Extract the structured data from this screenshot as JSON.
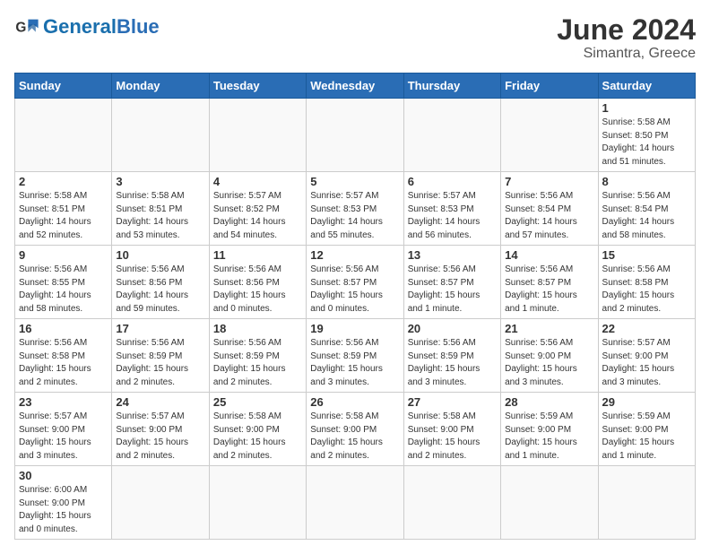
{
  "header": {
    "logo_general": "General",
    "logo_blue": "Blue",
    "month_title": "June 2024",
    "location": "Simantra, Greece"
  },
  "weekdays": [
    "Sunday",
    "Monday",
    "Tuesday",
    "Wednesday",
    "Thursday",
    "Friday",
    "Saturday"
  ],
  "days": {
    "d1": {
      "num": "1",
      "info": "Sunrise: 5:58 AM\nSunset: 8:50 PM\nDaylight: 14 hours\nand 51 minutes."
    },
    "d2": {
      "num": "2",
      "info": "Sunrise: 5:58 AM\nSunset: 8:51 PM\nDaylight: 14 hours\nand 52 minutes."
    },
    "d3": {
      "num": "3",
      "info": "Sunrise: 5:58 AM\nSunset: 8:51 PM\nDaylight: 14 hours\nand 53 minutes."
    },
    "d4": {
      "num": "4",
      "info": "Sunrise: 5:57 AM\nSunset: 8:52 PM\nDaylight: 14 hours\nand 54 minutes."
    },
    "d5": {
      "num": "5",
      "info": "Sunrise: 5:57 AM\nSunset: 8:53 PM\nDaylight: 14 hours\nand 55 minutes."
    },
    "d6": {
      "num": "6",
      "info": "Sunrise: 5:57 AM\nSunset: 8:53 PM\nDaylight: 14 hours\nand 56 minutes."
    },
    "d7": {
      "num": "7",
      "info": "Sunrise: 5:56 AM\nSunset: 8:54 PM\nDaylight: 14 hours\nand 57 minutes."
    },
    "d8": {
      "num": "8",
      "info": "Sunrise: 5:56 AM\nSunset: 8:54 PM\nDaylight: 14 hours\nand 58 minutes."
    },
    "d9": {
      "num": "9",
      "info": "Sunrise: 5:56 AM\nSunset: 8:55 PM\nDaylight: 14 hours\nand 58 minutes."
    },
    "d10": {
      "num": "10",
      "info": "Sunrise: 5:56 AM\nSunset: 8:56 PM\nDaylight: 14 hours\nand 59 minutes."
    },
    "d11": {
      "num": "11",
      "info": "Sunrise: 5:56 AM\nSunset: 8:56 PM\nDaylight: 15 hours\nand 0 minutes."
    },
    "d12": {
      "num": "12",
      "info": "Sunrise: 5:56 AM\nSunset: 8:57 PM\nDaylight: 15 hours\nand 0 minutes."
    },
    "d13": {
      "num": "13",
      "info": "Sunrise: 5:56 AM\nSunset: 8:57 PM\nDaylight: 15 hours\nand 1 minute."
    },
    "d14": {
      "num": "14",
      "info": "Sunrise: 5:56 AM\nSunset: 8:57 PM\nDaylight: 15 hours\nand 1 minute."
    },
    "d15": {
      "num": "15",
      "info": "Sunrise: 5:56 AM\nSunset: 8:58 PM\nDaylight: 15 hours\nand 2 minutes."
    },
    "d16": {
      "num": "16",
      "info": "Sunrise: 5:56 AM\nSunset: 8:58 PM\nDaylight: 15 hours\nand 2 minutes."
    },
    "d17": {
      "num": "17",
      "info": "Sunrise: 5:56 AM\nSunset: 8:59 PM\nDaylight: 15 hours\nand 2 minutes."
    },
    "d18": {
      "num": "18",
      "info": "Sunrise: 5:56 AM\nSunset: 8:59 PM\nDaylight: 15 hours\nand 2 minutes."
    },
    "d19": {
      "num": "19",
      "info": "Sunrise: 5:56 AM\nSunset: 8:59 PM\nDaylight: 15 hours\nand 3 minutes."
    },
    "d20": {
      "num": "20",
      "info": "Sunrise: 5:56 AM\nSunset: 8:59 PM\nDaylight: 15 hours\nand 3 minutes."
    },
    "d21": {
      "num": "21",
      "info": "Sunrise: 5:56 AM\nSunset: 9:00 PM\nDaylight: 15 hours\nand 3 minutes."
    },
    "d22": {
      "num": "22",
      "info": "Sunrise: 5:57 AM\nSunset: 9:00 PM\nDaylight: 15 hours\nand 3 minutes."
    },
    "d23": {
      "num": "23",
      "info": "Sunrise: 5:57 AM\nSunset: 9:00 PM\nDaylight: 15 hours\nand 3 minutes."
    },
    "d24": {
      "num": "24",
      "info": "Sunrise: 5:57 AM\nSunset: 9:00 PM\nDaylight: 15 hours\nand 2 minutes."
    },
    "d25": {
      "num": "25",
      "info": "Sunrise: 5:58 AM\nSunset: 9:00 PM\nDaylight: 15 hours\nand 2 minutes."
    },
    "d26": {
      "num": "26",
      "info": "Sunrise: 5:58 AM\nSunset: 9:00 PM\nDaylight: 15 hours\nand 2 minutes."
    },
    "d27": {
      "num": "27",
      "info": "Sunrise: 5:58 AM\nSunset: 9:00 PM\nDaylight: 15 hours\nand 2 minutes."
    },
    "d28": {
      "num": "28",
      "info": "Sunrise: 5:59 AM\nSunset: 9:00 PM\nDaylight: 15 hours\nand 1 minute."
    },
    "d29": {
      "num": "29",
      "info": "Sunrise: 5:59 AM\nSunset: 9:00 PM\nDaylight: 15 hours\nand 1 minute."
    },
    "d30": {
      "num": "30",
      "info": "Sunrise: 6:00 AM\nSunset: 9:00 PM\nDaylight: 15 hours\nand 0 minutes."
    }
  }
}
